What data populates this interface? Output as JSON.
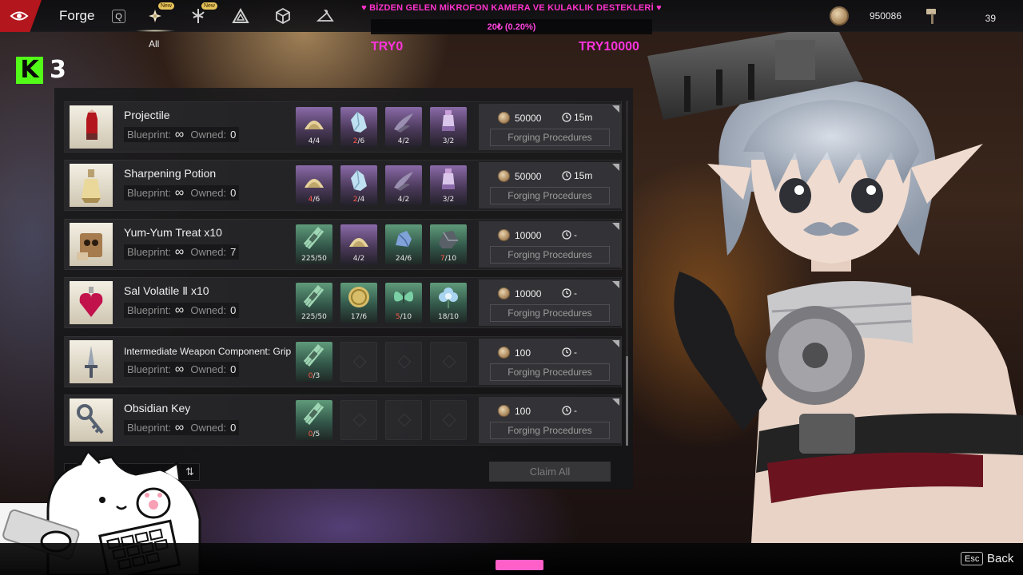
{
  "header": {
    "title": "Forge",
    "hotkey_left": "Q",
    "active_category_label": "All",
    "new_badge": "New",
    "category_tabs": [
      {
        "icon": "flower-icon",
        "active": true,
        "badge": true
      },
      {
        "icon": "crest-icon",
        "active": false,
        "badge": true
      },
      {
        "icon": "triangle-knot-icon",
        "active": false,
        "badge": false
      },
      {
        "icon": "cube-icon",
        "active": false,
        "badge": false
      },
      {
        "icon": "hanger-icon",
        "active": false,
        "badge": false
      }
    ],
    "currencies": [
      {
        "icon": "coin-icon",
        "amount": "950086"
      },
      {
        "icon": "hammer-icon",
        "amount": "39"
      }
    ]
  },
  "stream_overlay": {
    "banner": "♥ BİZDEN GELEN MİKROFON KAMERA VE KULAKLIK DESTEKLERİ ♥",
    "progress": "20₺ (0.20%)",
    "goal_current": "TRY0",
    "goal_target": "TRY10000",
    "channel_number": "3",
    "brand_letter": "K"
  },
  "forge": {
    "blueprint_label": "Blueprint:",
    "owned_label": "Owned:",
    "infinity": "∞",
    "procedures_label": "Forging Procedures",
    "claim_all_label": "Claim All",
    "items": [
      {
        "name": "Projectile",
        "owned": "0",
        "cost": "50000",
        "time": "15m",
        "icon": "projectile-icon",
        "materials": [
          {
            "icon": "sand-pile-icon",
            "tone": "pink",
            "have": "4",
            "need": "4",
            "short": false
          },
          {
            "icon": "crystal-icon",
            "tone": "pink",
            "have": "2",
            "need": "6",
            "short": true
          },
          {
            "icon": "horn-icon",
            "tone": "pink",
            "have": "4",
            "need": "2",
            "short": false
          },
          {
            "icon": "vial-icon",
            "tone": "pink",
            "have": "3",
            "need": "2",
            "short": false
          }
        ]
      },
      {
        "name": "Sharpening Potion",
        "owned": "0",
        "cost": "50000",
        "time": "15m",
        "icon": "potion-icon",
        "materials": [
          {
            "icon": "sand-pile-icon",
            "tone": "pink",
            "have": "4",
            "need": "6",
            "short": true
          },
          {
            "icon": "crystal-icon",
            "tone": "pink",
            "have": "2",
            "need": "4",
            "short": true
          },
          {
            "icon": "horn-icon",
            "tone": "pink",
            "have": "4",
            "need": "2",
            "short": false
          },
          {
            "icon": "vial-icon",
            "tone": "pink",
            "have": "3",
            "need": "2",
            "short": false
          }
        ]
      },
      {
        "name": "Yum-Yum Treat x10",
        "owned": "7",
        "cost": "10000",
        "time": "-",
        "icon": "treat-box-icon",
        "materials": [
          {
            "icon": "bundle-icon",
            "tone": "green",
            "have": "225",
            "need": "50",
            "short": false
          },
          {
            "icon": "sand-pile-icon",
            "tone": "pink",
            "have": "4",
            "need": "2",
            "short": false
          },
          {
            "icon": "ore-icon",
            "tone": "green",
            "have": "24",
            "need": "6",
            "short": false
          },
          {
            "icon": "dark-ore-icon",
            "tone": "green",
            "have": "7",
            "need": "10",
            "short": true
          }
        ]
      },
      {
        "name": "Sal Volatile Ⅱ x10",
        "owned": "0",
        "cost": "10000",
        "time": "-",
        "icon": "heart-flask-icon",
        "materials": [
          {
            "icon": "bundle-icon",
            "tone": "green",
            "have": "225",
            "need": "50",
            "short": false
          },
          {
            "icon": "gold-coin-icon",
            "tone": "green",
            "have": "17",
            "need": "6",
            "short": false
          },
          {
            "icon": "butterfly-icon",
            "tone": "green",
            "have": "5",
            "need": "10",
            "short": true
          },
          {
            "icon": "blue-flower-icon",
            "tone": "green",
            "have": "18",
            "need": "10",
            "short": false
          }
        ]
      },
      {
        "name": "Intermediate Weapon Component: Grip",
        "owned": "0",
        "cost": "100",
        "time": "-",
        "icon": "dagger-icon",
        "materials": [
          {
            "icon": "bundle-icon",
            "tone": "green",
            "have": "0",
            "need": "3",
            "short": true
          }
        ]
      },
      {
        "name": "Obsidian Key",
        "owned": "0",
        "cost": "100",
        "time": "-",
        "icon": "key-icon",
        "materials": [
          {
            "icon": "bundle-icon",
            "tone": "green",
            "have": "0",
            "need": "5",
            "short": true
          }
        ]
      }
    ]
  },
  "footer": {
    "esc_key": "Esc",
    "back_label": "Back"
  },
  "colors": {
    "accent_red": "#b3161c",
    "overlay_pink": "#ff33cc",
    "shortage_red": "#ff5a4a",
    "kick_green": "#53fc18"
  }
}
